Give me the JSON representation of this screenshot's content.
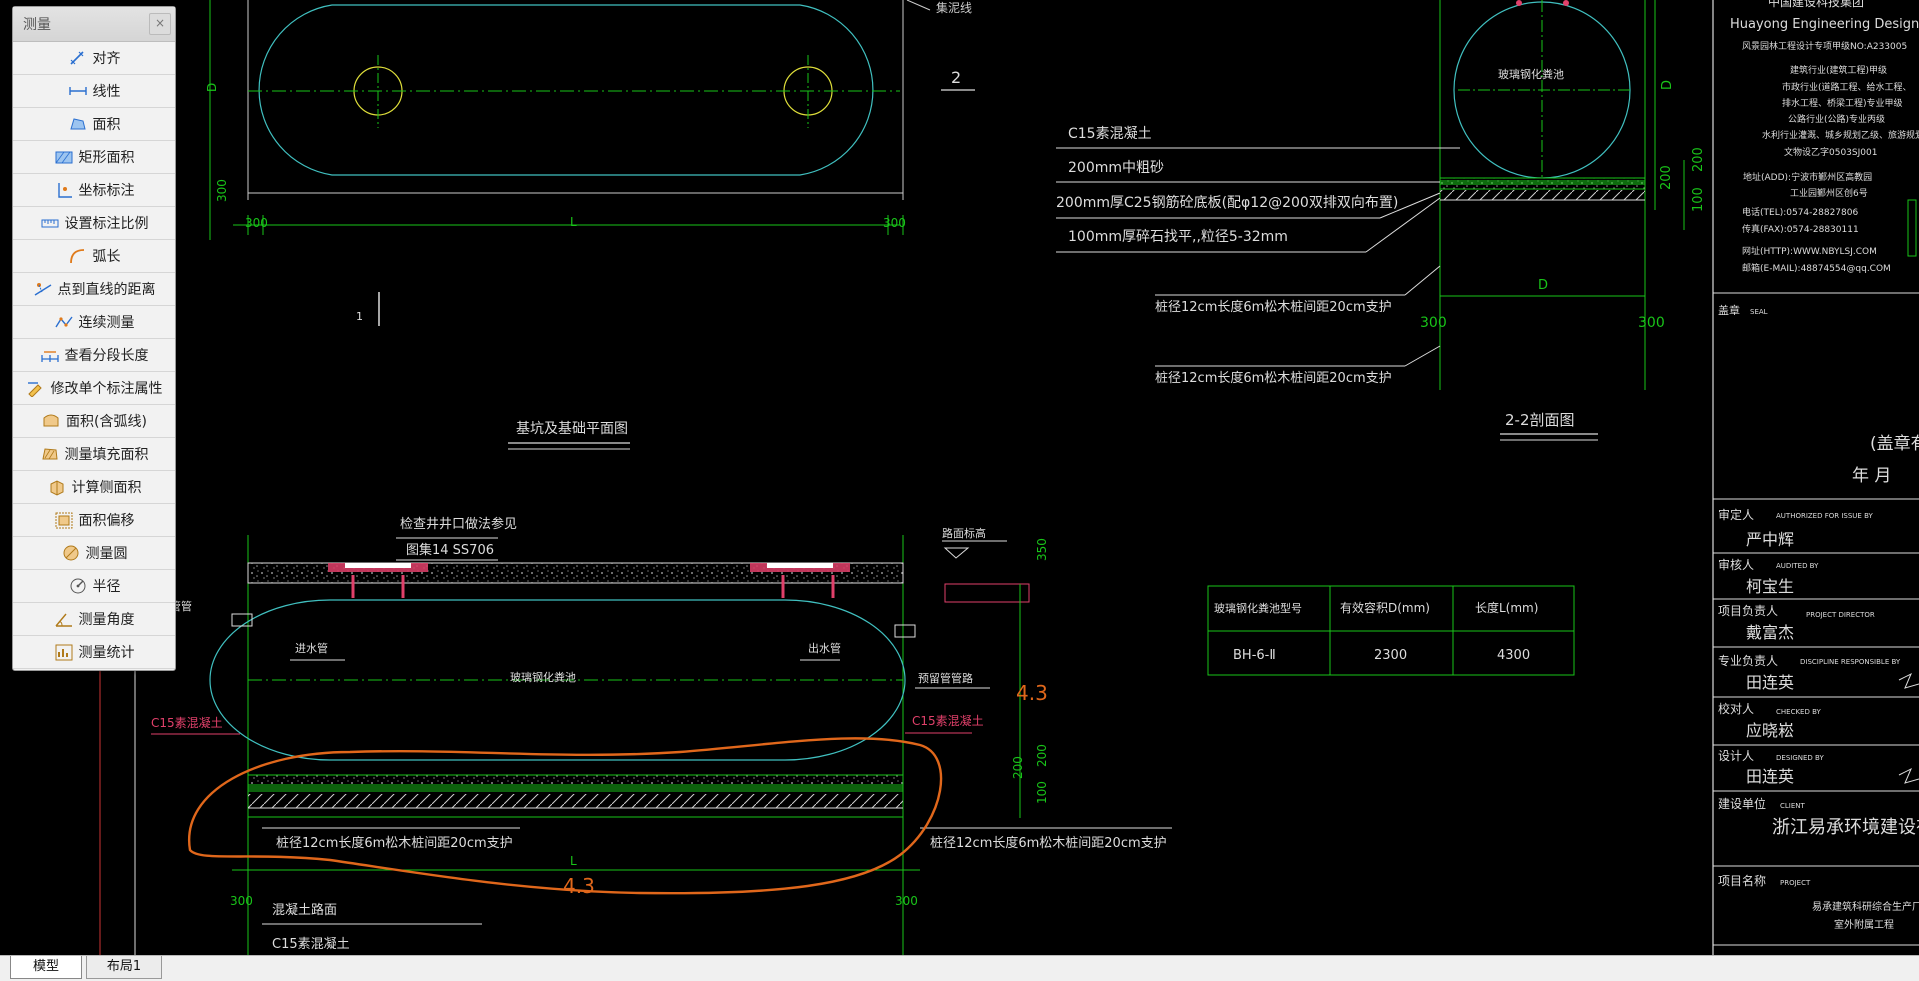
{
  "measure_panel": {
    "title": "测量",
    "close_glyph": "×",
    "tools": [
      {
        "label": "对齐",
        "icon": "align-measure-icon"
      },
      {
        "label": "线性",
        "icon": "linear-measure-icon"
      },
      {
        "label": "面积",
        "icon": "area-icon"
      },
      {
        "label": "矩形面积",
        "icon": "rectangle-area-icon"
      },
      {
        "label": "坐标标注",
        "icon": "coordinate-icon"
      },
      {
        "label": "设置标注比例",
        "icon": "scale-icon"
      },
      {
        "label": "弧长",
        "icon": "arc-length-icon"
      },
      {
        "label": "点到直线的距离",
        "icon": "point-line-distance-icon"
      },
      {
        "label": "连续测量",
        "icon": "continuous-measure-icon"
      },
      {
        "label": "查看分段长度",
        "icon": "segment-length-icon"
      },
      {
        "label": "修改单个标注属性",
        "icon": "edit-dimension-icon"
      },
      {
        "label": "面积(含弧线)",
        "icon": "arc-area-icon"
      },
      {
        "label": "测量填充面积",
        "icon": "hatch-area-icon"
      },
      {
        "label": "计算侧面积",
        "icon": "side-area-icon"
      },
      {
        "label": "面积偏移",
        "icon": "area-offset-icon"
      },
      {
        "label": "测量圆",
        "icon": "circle-measure-icon"
      },
      {
        "label": "半径",
        "icon": "radius-icon"
      },
      {
        "label": "测量角度",
        "icon": "angle-icon"
      },
      {
        "label": "测量统计",
        "icon": "statistics-icon"
      }
    ]
  },
  "tabs": [
    "模型",
    "布局1"
  ],
  "drawing": {
    "top_plan": {
      "dim_left": "300",
      "dim_right": "300",
      "dim_mid": "L",
      "dim_side": "D",
      "dim_side_low": "300",
      "top_label": "集泥线",
      "section_mark": "2",
      "section_mark2": "1"
    },
    "plan_title": "基坑及基础平面图",
    "section_22": {
      "tank_label": "玻璃钢化粪池",
      "layers": [
        "C15素混凝土",
        "200mm中粗砂",
        "200mm厚C25钢筋砼底板(配φ12@200双排双向布置)",
        "100mm厚碎石找平,,粒径5-32mm"
      ],
      "piles": [
        "桩径12cm长度6m松木桩间距20cm支护",
        "桩径12cm长度6m松木桩间距20cm支护"
      ],
      "dim_d": "D",
      "dim_left": "300",
      "dim_right": "300",
      "right_dims": [
        "D",
        "200",
        "100",
        "200"
      ],
      "title": "2-2剖面图"
    },
    "section_11": {
      "note1": "检查井井口做法参见",
      "note2": "图集14 SS706",
      "road": "路面标高",
      "inlet_pipe": "进水管",
      "outlet_pipe": "出水管",
      "left_pipe": "管管",
      "vent": "预留管管路",
      "tank_label": "玻璃钢化粪池",
      "c15_left": "C15素混凝土",
      "c15_right": "C15素混凝土",
      "pile_left": "桩径12cm长度6m松木桩间距20cm支护",
      "pile_right": "桩径12cm长度6m松木桩间距20cm支护",
      "dim_350": "350",
      "dim_200a": "200",
      "dim_200b": "200",
      "dim_100": "100",
      "dim_l": "L",
      "dim_300_left": "300",
      "dim_300_right": "300",
      "bottom1": "混凝土路面",
      "bottom2": "C15素混凝土"
    },
    "markup": {
      "text1": "4.3",
      "text2": "4.3",
      "color": "#e0671b"
    },
    "spec_table": {
      "headers": [
        "玻璃钢化粪池型号",
        "有效容积D(mm)",
        "长度L(mm)"
      ],
      "row": [
        "BH-6-Ⅱ",
        "2300",
        "4300"
      ]
    },
    "title_block": {
      "company_top": "中国建设科技集团",
      "company_en": "Huayong Engineering Design G",
      "cert_no": "风景园林工程设计专项甲级NO:A233005",
      "quals": [
        "建筑行业(建筑工程)甲级",
        "市政行业(道路工程、给水工程、",
        "排水工程、桥梁工程)专业甲级",
        "公路行业(公路)专业丙级",
        "水利行业灌溉、城乡规划乙级、旅游规划",
        "文物设乙字0503SJ001"
      ],
      "address1": "地址(ADD):宁波市鄞州区高教园",
      "address2": "工业园鄞州区创6号",
      "tel": "电话(TEL):0574-28827806",
      "fax": "传真(FAX):0574-28830111",
      "http": "网址(HTTP):WWW.NBYLSJ.COM",
      "email": "邮箱(E-MAIL):48874554@qq.COM",
      "seal": "盖章",
      "seal_en": "SEAL",
      "seal_note": "(盖章有",
      "year_month": "年    月",
      "roles": [
        {
          "role": "审定人",
          "en": "AUTHORIZED FOR ISSUE BY",
          "name": "严中辉"
        },
        {
          "role": "审核人",
          "en": "AUDITED BY",
          "name": "柯宝生"
        },
        {
          "role": "项目负责人",
          "en": "PROJECT DIRECTOR",
          "name": "戴富杰"
        },
        {
          "role": "专业负责人",
          "en": "DISCIPLINE RESPONSIBLE BY",
          "name": "田连英"
        },
        {
          "role": "校对人",
          "en": "CHECKED BY",
          "name": "应晓崧"
        },
        {
          "role": "设计人",
          "en": "DESIGNED BY",
          "name": "田连英"
        }
      ],
      "client_label": "建设单位",
      "client_en": "CLIENT",
      "client": "浙江易承环境建设有",
      "project_label": "项目名称",
      "project_en": "PROJECT",
      "project1": "易承建筑科研综合生产厂房扩建",
      "project2": "室外附属工程"
    }
  }
}
